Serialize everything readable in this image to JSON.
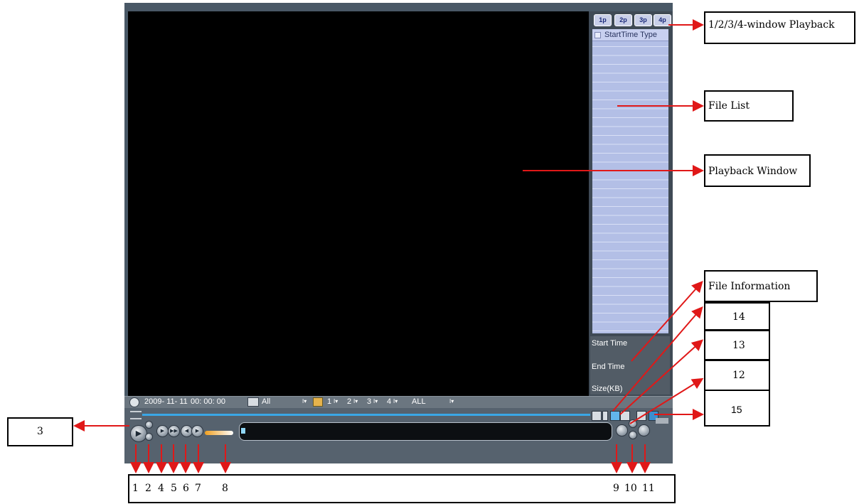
{
  "window_tabs": [
    "1p",
    "2p",
    "3p",
    "4p"
  ],
  "file_list": {
    "header": "StartTime Type"
  },
  "file_info": {
    "start_time": "Start Time",
    "end_time": "End Time",
    "size": "Size(KB)"
  },
  "bar": {
    "datetime": "2009- 11- 11",
    "time": "00: 00: 00",
    "record_type": "All",
    "channels": [
      "1",
      "2",
      "3",
      "4"
    ],
    "filter": "ALL"
  },
  "callouts": {
    "playback_multi": "1/2/3/4-window Playback",
    "file_list": "File List",
    "playback_window": "Playback Window",
    "file_information": "File Information",
    "n14": "14",
    "n13": "13",
    "n12": "12",
    "n15": "15",
    "n3": "3"
  },
  "bottom_numbers": [
    "1",
    "2",
    "4",
    "5",
    "6",
    "7",
    "8",
    "9",
    "10",
    "11"
  ],
  "colors": {
    "arrow": "#e01818",
    "panel": "#b3bfe6",
    "progress": "#3aa7e6"
  }
}
